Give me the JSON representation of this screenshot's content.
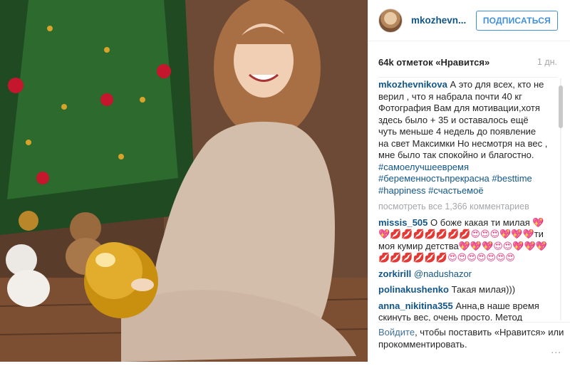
{
  "post": {
    "username": "mkozhevn...",
    "follow_label": "ПОДПИСАТЬСЯ",
    "likes_text": "64k отметок «Нравится»",
    "time": "1 дн."
  },
  "caption": {
    "username": "mkozhevnikova",
    "text": "А это для всех, кто не верил , что я набрала почти 40 кг Фотография Вам для мотивации,хотя здесь было + 35 и оставалось ещё чуть меньше 4 недель до появление на свет Максимки  Но несмотря на вес , мне было так спокойно и благостно.",
    "hashtags": [
      "#самоелучшеевремя",
      "#беременностьпрекрасна",
      "#besttime",
      "#happiness",
      "#счастьемоё"
    ]
  },
  "view_all": "посмотреть все 1,366 комментариев",
  "comments": [
    {
      "user": "missis_505",
      "parts": [
        {
          "t": "О боже какая ти милая ",
          "c": ""
        },
        {
          "t": "💖💖💋💋💋💋💋💋💋😍😍😍💖💖💖",
          "c": "heart"
        },
        {
          "t": "ти моя кумир детства",
          "c": ""
        },
        {
          "t": "💖💖💖😍😍💖💖💖💋💋💋💋💋💋😍😍😍😍😍😍😍",
          "c": "heart"
        }
      ]
    },
    {
      "user": "zorkirill",
      "parts": [
        {
          "t": "@nadushazor",
          "c": "tag"
        }
      ]
    },
    {
      "user": "polinakushenko",
      "parts": [
        {
          "t": "Такая милая)))",
          "c": ""
        }
      ]
    },
    {
      "user": "anna_nikitina355",
      "parts": [
        {
          "t": "Анна,в наше время скинуть вес, очень просто. Метод",
          "c": ""
        }
      ]
    }
  ],
  "footer": {
    "login_link": "Войдите",
    "rest": ", чтобы поставить «Нравится» или прокомментировать.",
    "more_icon": "..."
  }
}
